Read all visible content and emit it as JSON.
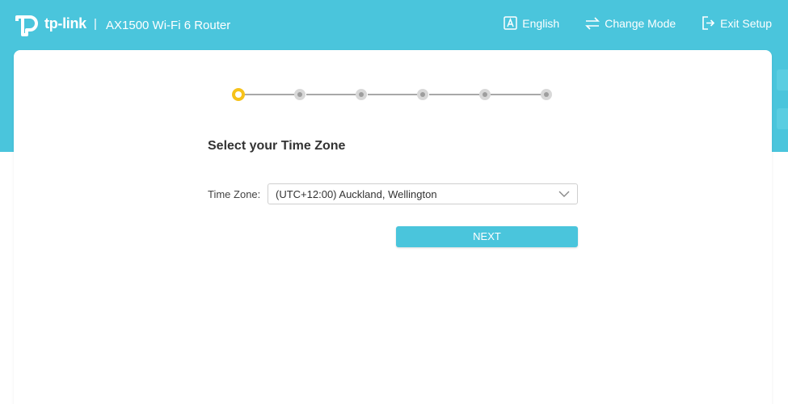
{
  "header": {
    "brand": "tp-link",
    "divider": "|",
    "product": "AX1500 Wi-Fi 6 Router",
    "actions": [
      {
        "label": "English",
        "icon": "language-icon"
      },
      {
        "label": "Change Mode",
        "icon": "change-mode-icon"
      },
      {
        "label": "Exit Setup",
        "icon": "exit-icon"
      }
    ]
  },
  "stepper": {
    "total_steps": 6,
    "current_step": 1
  },
  "main": {
    "title": "Select your Time Zone",
    "timezone_label": "Time Zone:",
    "timezone_value": "(UTC+12:00) Auckland, Wellington",
    "next_label": "NEXT"
  },
  "colors": {
    "brand_teal": "#4ac5dc",
    "active_step": "#f6c21a",
    "inactive_step": "#d8d8d8"
  }
}
